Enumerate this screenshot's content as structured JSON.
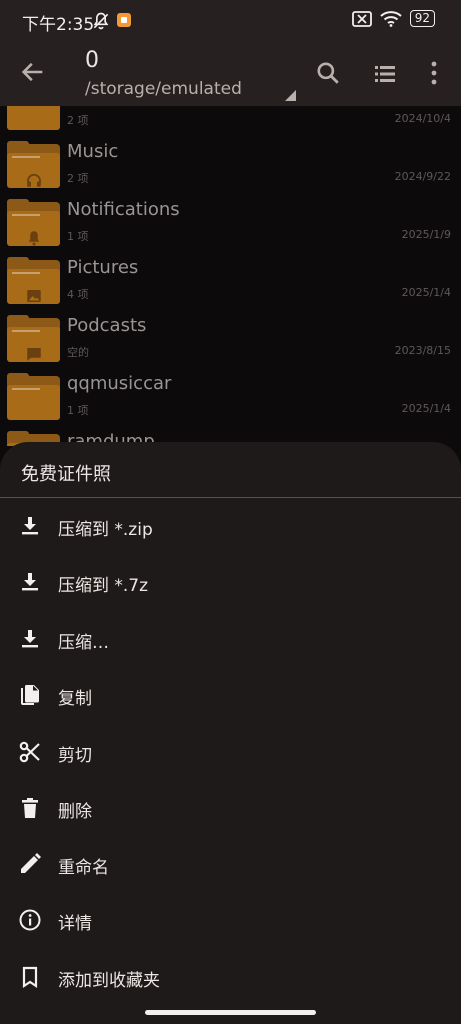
{
  "status_bar": {
    "time": "下午2:35",
    "battery": "92",
    "icons": [
      "mute-icon",
      "app-notification-icon",
      "no-sim-icon",
      "wifi-icon",
      "battery-icon"
    ]
  },
  "toolbar": {
    "title": "0",
    "path": "/storage/emulated",
    "icons": [
      "back-arrow-icon",
      "search-icon",
      "list-view-icon",
      "more-vert-icon"
    ]
  },
  "files": [
    {
      "name": "",
      "count": "2 项",
      "date": "2024/10/4",
      "icon": "folder-icon"
    },
    {
      "name": "Music",
      "count": "2 项",
      "date": "2024/9/22",
      "icon": "headphones-icon"
    },
    {
      "name": "Notifications",
      "count": "1 项",
      "date": "2025/1/9",
      "icon": "bell-icon"
    },
    {
      "name": "Pictures",
      "count": "4 项",
      "date": "2025/1/4",
      "icon": "image-icon"
    },
    {
      "name": "Podcasts",
      "count": "空的",
      "date": "2023/8/15",
      "icon": "chat-icon"
    },
    {
      "name": "qqmusiccar",
      "count": "1 项",
      "date": "2025/1/4",
      "icon": "folder-icon"
    },
    {
      "name": "ramdump",
      "count": "",
      "date": "",
      "icon": "folder-icon"
    }
  ],
  "sheet": {
    "title": "免费证件照",
    "items": [
      {
        "label": "压缩到 *.zip",
        "icon": "download-icon"
      },
      {
        "label": "压缩到 *.7z",
        "icon": "download-icon"
      },
      {
        "label": "压缩…",
        "icon": "download-icon"
      },
      {
        "label": "复制",
        "icon": "copy-icon"
      },
      {
        "label": "剪切",
        "icon": "scissors-icon"
      },
      {
        "label": "删除",
        "icon": "trash-icon"
      },
      {
        "label": "重命名",
        "icon": "pencil-icon"
      },
      {
        "label": "详情",
        "icon": "info-icon"
      },
      {
        "label": "添加到收藏夹",
        "icon": "bookmark-icon"
      }
    ]
  },
  "colors": {
    "background": "#0d0a0b",
    "bar": "#262020",
    "sheet": "#1f1a1a",
    "folder": "#a86b18",
    "accent_divider": "#6b4a3a"
  }
}
